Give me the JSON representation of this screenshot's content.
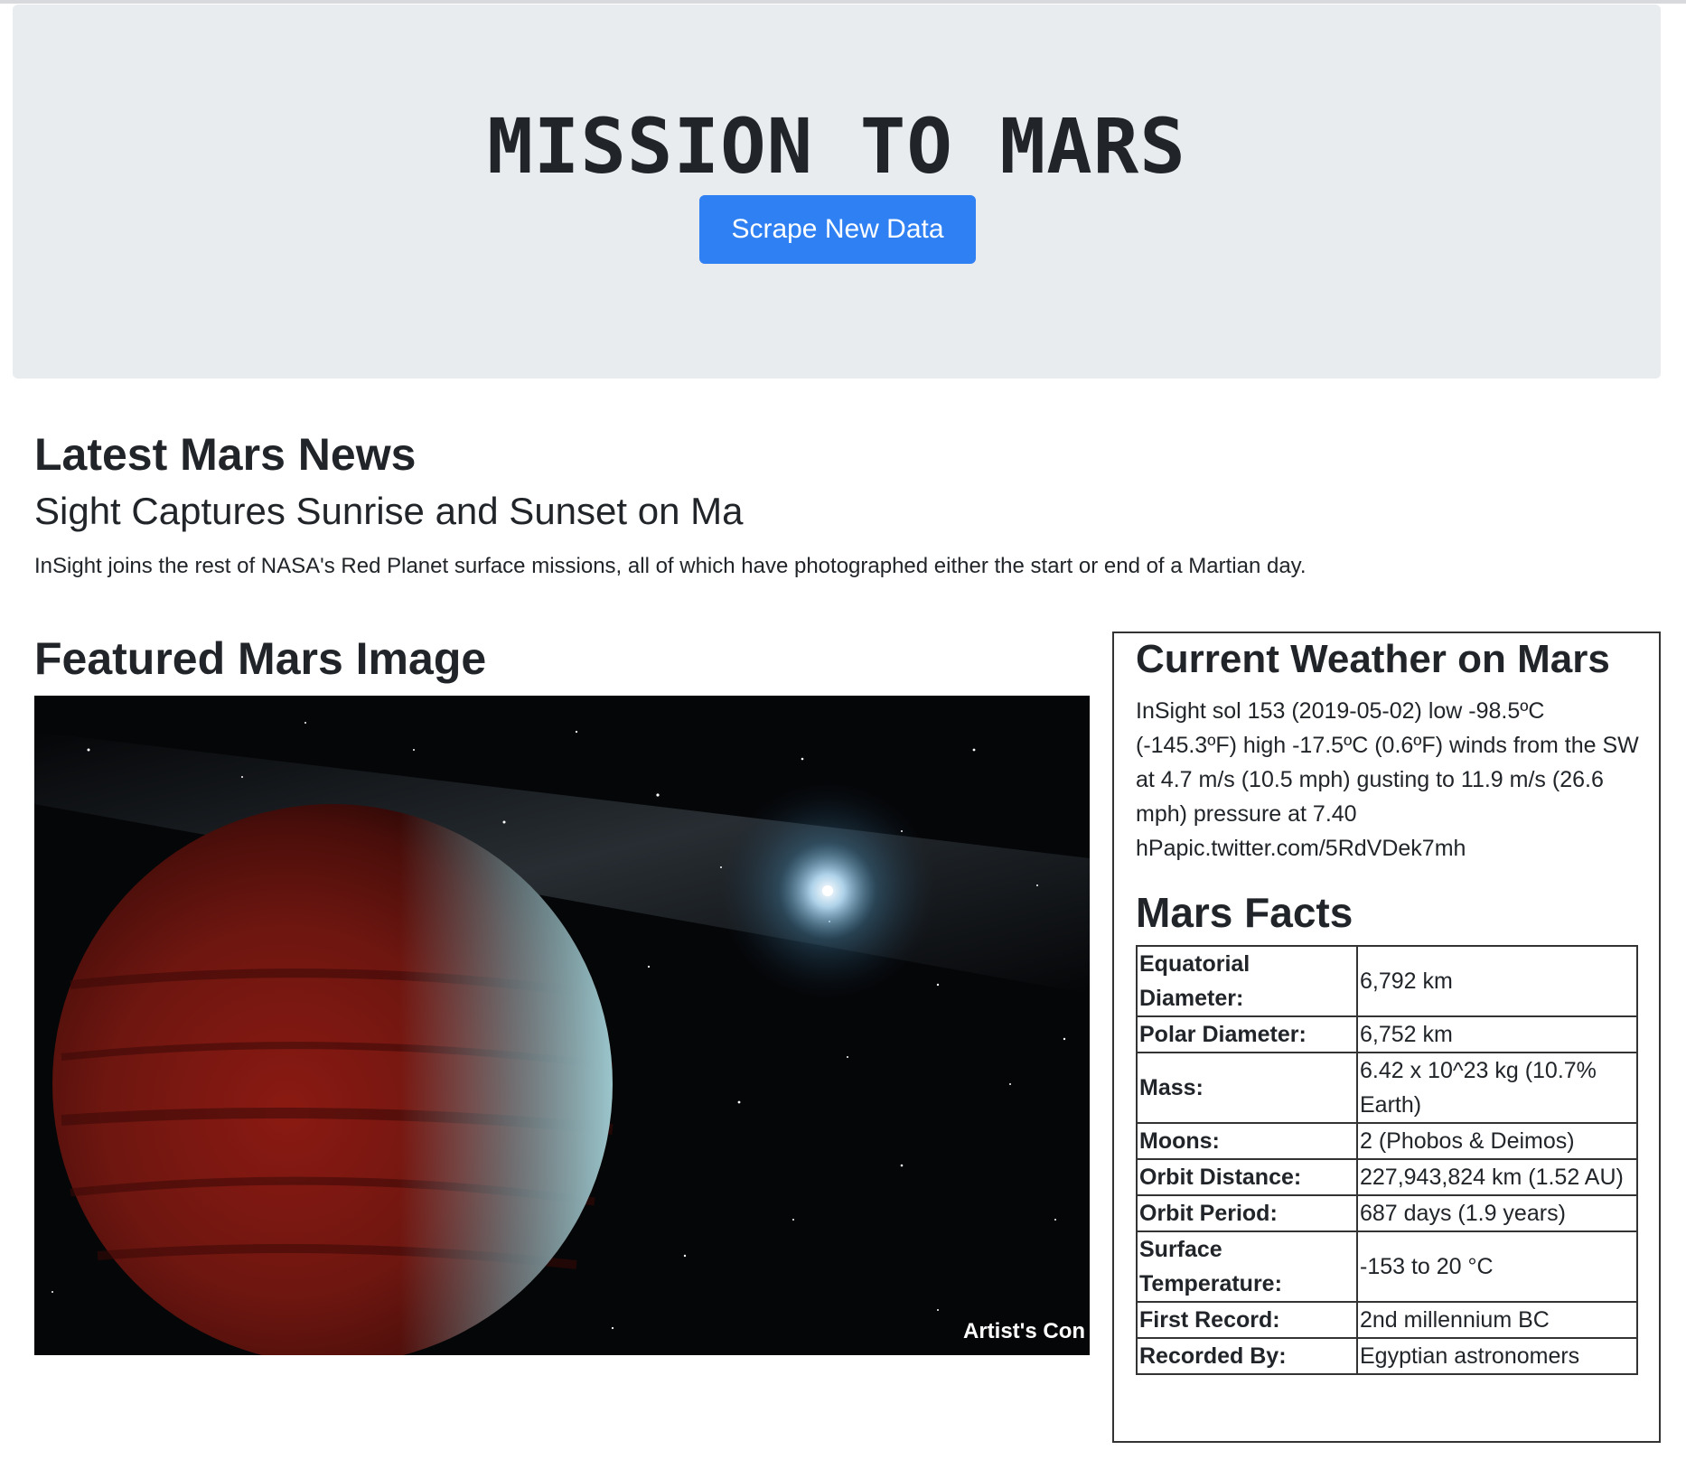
{
  "header": {
    "title": "MISSION TO MARS",
    "scrape_button_label": "Scrape New Data"
  },
  "news": {
    "heading": "Latest Mars News",
    "title": "Sight Captures Sunrise and Sunset on Ma",
    "teaser": "InSight joins the rest of NASA's Red Planet surface missions, all of which have photographed either the start or end of a Martian day."
  },
  "featured": {
    "heading": "Featured Mars Image",
    "caption": "Artist's Con"
  },
  "weather": {
    "heading": "Current Weather on Mars",
    "text": "InSight sol 153 (2019-05-02) low -98.5ºC (-145.3ºF) high -17.5ºC (0.6ºF) winds from the SW at 4.7 m/s (10.5 mph) gusting to 11.9 m/s (26.6 mph) pressure at 7.40 hPapic.twitter.com/5RdVDek7mh"
  },
  "facts": {
    "heading": "Mars Facts",
    "rows": [
      {
        "label": "Equatorial Diameter:",
        "value": "6,792 km"
      },
      {
        "label": "Polar Diameter:",
        "value": "6,752 km"
      },
      {
        "label": "Mass:",
        "value": "6.42 x 10^23 kg (10.7% Earth)"
      },
      {
        "label": "Moons:",
        "value": "2 (Phobos & Deimos)"
      },
      {
        "label": "Orbit Distance:",
        "value": "227,943,824 km (1.52 AU)"
      },
      {
        "label": "Orbit Period:",
        "value": "687 days (1.9 years)"
      },
      {
        "label": "Surface Temperature:",
        "value": "-153 to 20 °C"
      },
      {
        "label": "First Record:",
        "value": "2nd millennium BC"
      },
      {
        "label": "Recorded By:",
        "value": "Egyptian astronomers"
      }
    ]
  },
  "colors": {
    "jumbotron_bg": "#e9ecef",
    "primary_button": "#2f80f2",
    "text": "#212529"
  }
}
